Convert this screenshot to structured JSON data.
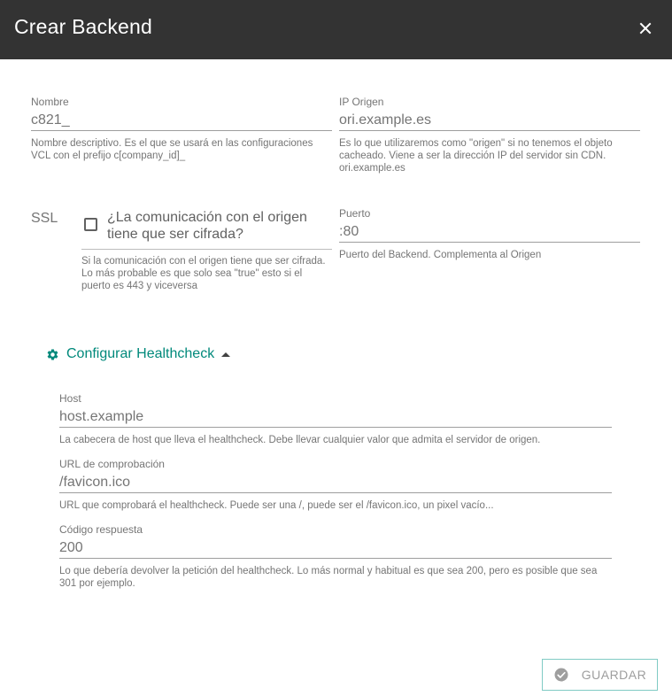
{
  "dialog": {
    "title": "Crear Backend",
    "close_icon": "close-icon"
  },
  "form": {
    "nombre": {
      "label": "Nombre",
      "value": "c821_",
      "hint": "Nombre descriptivo. Es el que se usará en las configuraciones VCL con el prefijo c[company_id]_"
    },
    "ip_origen": {
      "label": "IP Origen",
      "value": "ori.example.es",
      "hint": "Es lo que utilizaremos como \"origen\" si no tenemos el objeto cacheado. Viene a ser la dirección IP del servidor sin CDN. ori.example.es"
    },
    "ssl": {
      "label": "SSL",
      "checkbox_label": "¿La comunicación con el origen tiene que ser cifrada?",
      "checked": false,
      "hint": "Si la comunicación con el origen tiene que ser cifrada. Lo más probable es que solo sea \"true\" esto si el puerto es 443 y viceversa"
    },
    "puerto": {
      "label": "Puerto",
      "value": ":80",
      "hint": "Puerto del Backend. Complementa al Origen"
    }
  },
  "healthcheck": {
    "toggle_label": "Configurar Healthcheck",
    "icon": "gear-icon",
    "expanded": true,
    "host": {
      "label": "Host",
      "value": "host.example",
      "hint": "La cabecera de host que lleva el healthcheck. Debe llevar cualquier valor que admita el servidor de origen."
    },
    "url": {
      "label": "URL de comprobación",
      "value": "/favicon.ico",
      "hint": "URL que comprobará el healthcheck. Puede ser una /, puede ser el /favicon.ico, un pixel vacío..."
    },
    "codigo": {
      "label": "Código respuesta",
      "value": "200",
      "hint": "Lo que debería devolver la petición del healthcheck. Lo más normal y habitual es que sea 200, pero es posible que sea 301 por ejemplo."
    }
  },
  "actions": {
    "save_label": "GUARDAR",
    "save_icon": "check-circle-icon"
  },
  "colors": {
    "header_bg": "#333333",
    "accent": "#00897b",
    "save_border": "#80cbc4"
  }
}
